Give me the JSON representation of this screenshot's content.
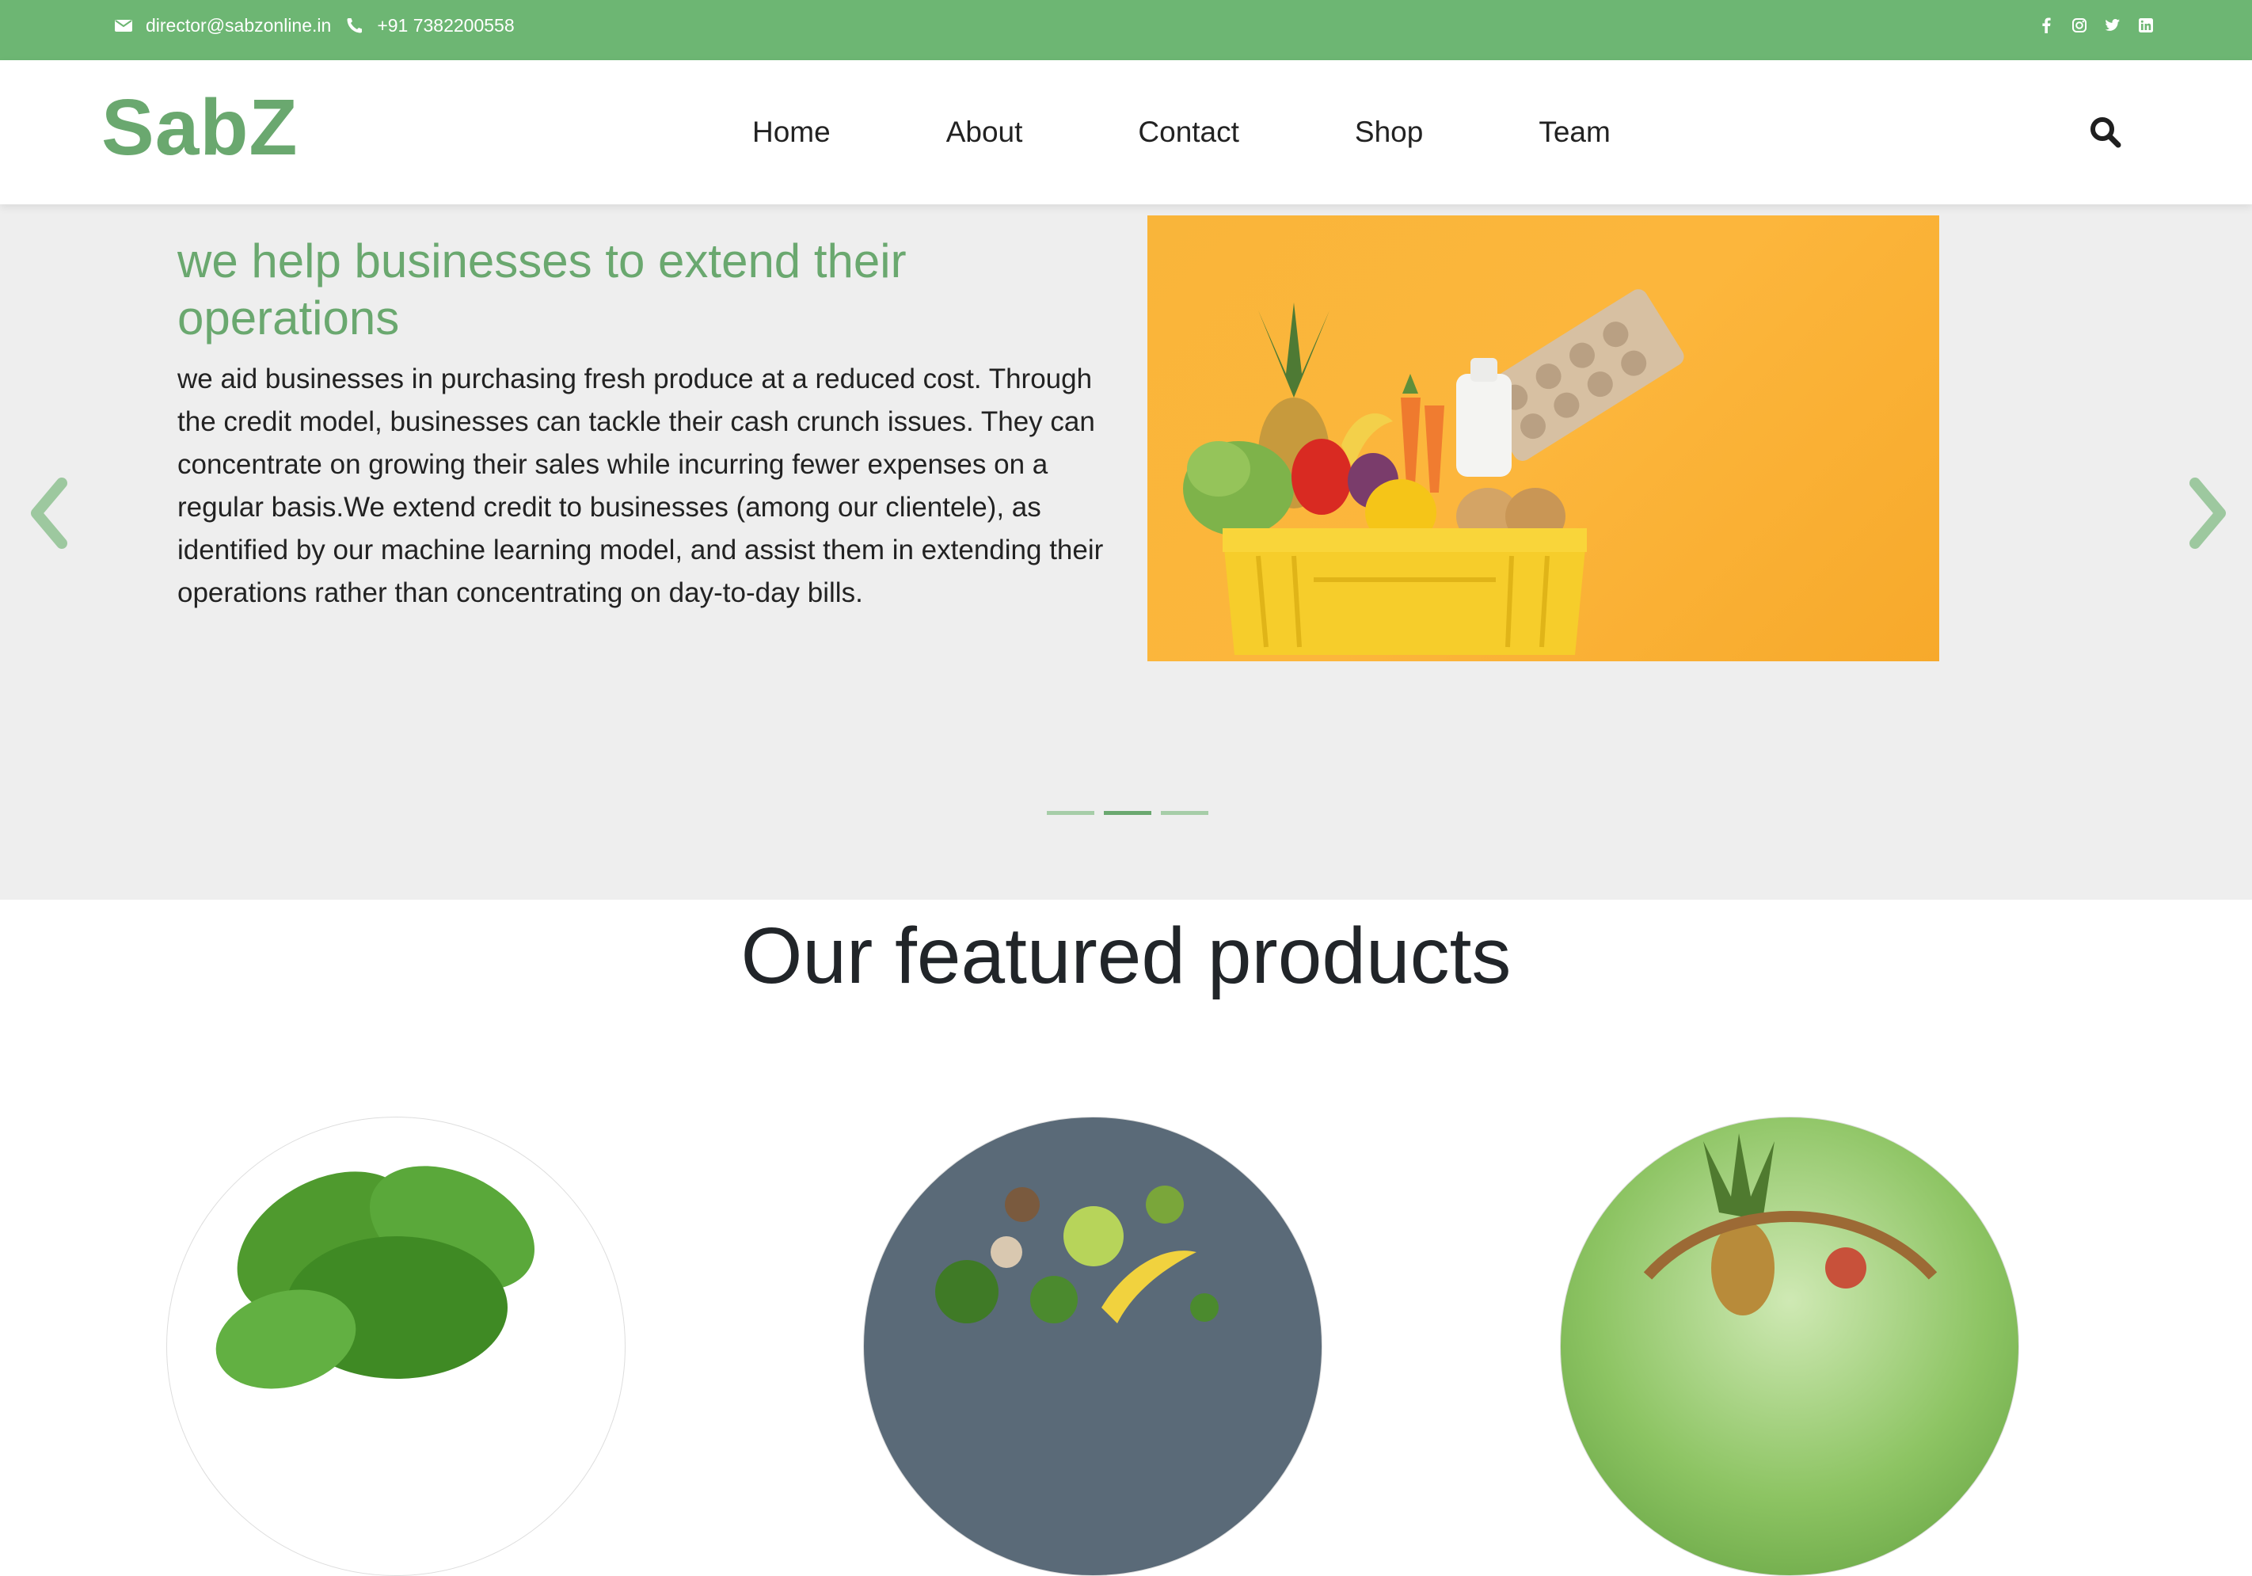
{
  "topbar": {
    "email": "director@sabzonline.in",
    "phone": "+91 7382200558",
    "email_icon": "envelope-icon",
    "phone_icon": "phone-icon",
    "social_icons": [
      "facebook-icon",
      "instagram-icon",
      "twitter-icon",
      "linkedin-icon"
    ],
    "background": "#6db673"
  },
  "header": {
    "logo": "SabZ",
    "nav": [
      "Home",
      "About",
      "Contact",
      "Shop",
      "Team"
    ],
    "search_icon": "search-icon"
  },
  "hero": {
    "title": "we help businesses to extend their operations",
    "body": "we aid businesses in purchasing fresh produce at a reduced cost. Through the credit model, businesses can tackle their cash crunch issues. They can concentrate on growing their sales while incurring fewer expenses on a regular basis.We extend credit to businesses (among our clientele), as identified by our machine learning model, and assist them in extending their operations rather than concentrating on day-to-day bills.",
    "image": "grocery-crate-image",
    "slides_total": 3,
    "active_slide": 2,
    "prev_icon": "chevron-left-icon",
    "next_icon": "chevron-right-icon"
  },
  "featured": {
    "title": "Our featured products",
    "products": [
      "leafy-greens-image",
      "assorted-vegetables-image",
      "fruit-basket-image"
    ]
  },
  "colors": {
    "accent": "#6aa86f",
    "hero_bg": "#eeeeee"
  }
}
